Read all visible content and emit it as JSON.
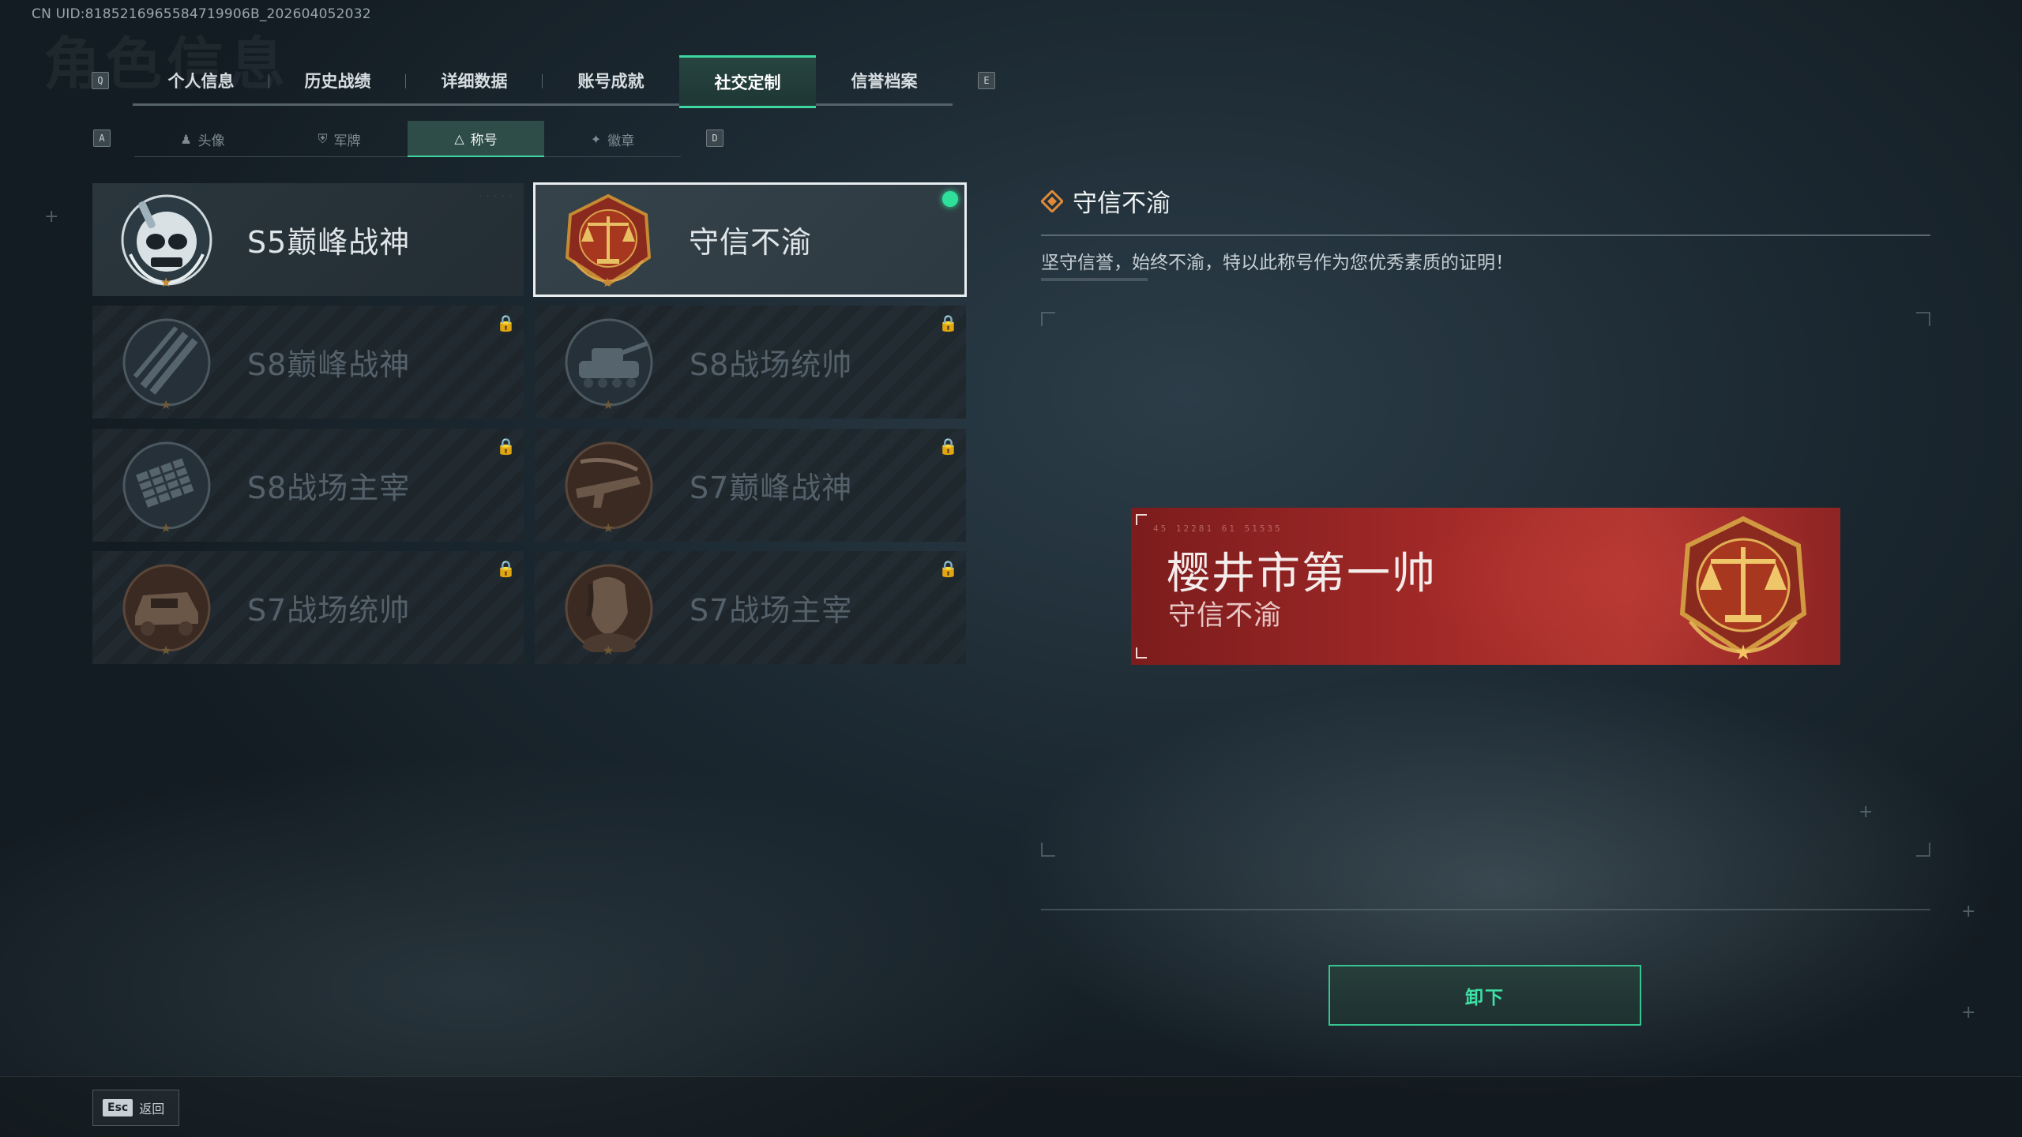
{
  "uid_text": "CN UID:8185216965584719906B_202604052032",
  "background_title": "角色信息",
  "keys": {
    "prev_tab": "Q",
    "next_tab": "E",
    "prev_sub": "A",
    "next_sub": "D"
  },
  "main_tabs": [
    {
      "label": "个人信息",
      "active": false
    },
    {
      "label": "历史战绩",
      "active": false
    },
    {
      "label": "详细数据",
      "active": false
    },
    {
      "label": "账号成就",
      "active": false
    },
    {
      "label": "社交定制",
      "active": true
    },
    {
      "label": "信誉档案",
      "active": false
    }
  ],
  "sub_tabs": [
    {
      "label": "头像",
      "icon": "person-icon",
      "active": false
    },
    {
      "label": "军牌",
      "icon": "dogtag-icon",
      "active": false
    },
    {
      "label": "称号",
      "icon": "title-icon",
      "active": true
    },
    {
      "label": "徽章",
      "icon": "badge-icon",
      "active": false
    }
  ],
  "titles": [
    {
      "name": "S5巅峰战神",
      "emblem": "skull-diver-emblem",
      "locked": false,
      "selected": false,
      "equipped": false
    },
    {
      "name": "守信不渝",
      "emblem": "scales-of-justice-emblem",
      "locked": false,
      "selected": true,
      "equipped": true
    },
    {
      "name": "S8巅峰战神",
      "emblem": "slash-emblem",
      "locked": true,
      "selected": false,
      "equipped": false
    },
    {
      "name": "S8战场统帅",
      "emblem": "tank-emblem",
      "locked": true,
      "selected": false,
      "equipped": false
    },
    {
      "name": "S8战场主宰",
      "emblem": "rocket-launcher-emblem",
      "locked": true,
      "selected": false,
      "equipped": false
    },
    {
      "name": "S7巅峰战神",
      "emblem": "rifle-emblem",
      "locked": true,
      "selected": false,
      "equipped": false
    },
    {
      "name": "S7战场统帅",
      "emblem": "armored-vehicle-emblem",
      "locked": true,
      "selected": false,
      "equipped": false
    },
    {
      "name": "S7战场主宰",
      "emblem": "soldier-portrait-emblem",
      "locked": true,
      "selected": false,
      "equipped": false
    }
  ],
  "detail": {
    "title": "守信不渝",
    "description": "坚守信誉，始终不渝，特以此称号作为您优秀素质的证明！"
  },
  "banner": {
    "player_name": "樱井市第一帅",
    "title": "守信不渝",
    "code": "45 12281 61 51535"
  },
  "unequip_label": "卸下",
  "footer": {
    "esc_key": "Esc",
    "back_label": "返回"
  },
  "colors": {
    "accent": "#3ed7a1",
    "equipped_dot": "#2fe09a",
    "banner_red": "#a32a28",
    "emblem_gold": "#c58a32"
  }
}
